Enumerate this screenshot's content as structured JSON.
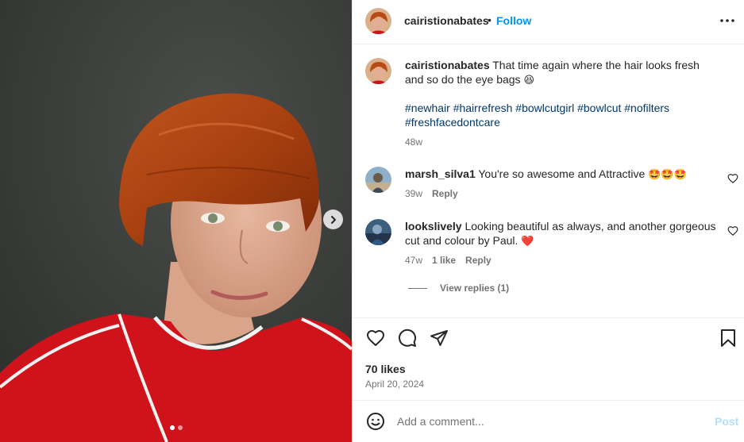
{
  "post": {
    "username": "cairistionabates",
    "separator": "•",
    "follow_label": "Follow",
    "more_icon": "more-horizontal-icon",
    "next_icon": "chevron-right-icon"
  },
  "caption": {
    "username": "cairistionabates",
    "text": "That time again where the hair looks fresh and so do the eye bags",
    "emoji": "😆",
    "hashtags_line1": "#newhair #hairrefresh #bowlcutgirl #bowlcut #nofilters",
    "hashtags_line2": "#freshfacedontcare",
    "time": "48w"
  },
  "comments": [
    {
      "username": "marsh_silva1",
      "text": "You're so awesome and Attractive",
      "emoji": "🤩🤩🤩",
      "time": "39w",
      "reply_label": "Reply"
    },
    {
      "username": "lookslively",
      "text": "Looking beautiful as always, and another gorgeous cut and colour by Paul.",
      "emoji": "❤️",
      "time": "47w",
      "likes_label": "1 like",
      "reply_label": "Reply",
      "view_replies_label": "View replies (1)"
    }
  ],
  "footer": {
    "likes": "70 likes",
    "date": "April 20, 2024",
    "comment_placeholder": "Add a comment...",
    "post_label": "Post"
  },
  "colors": {
    "accent": "#0095f6",
    "link": "#00376b",
    "muted": "#737373",
    "heart": "#ed1c24"
  }
}
